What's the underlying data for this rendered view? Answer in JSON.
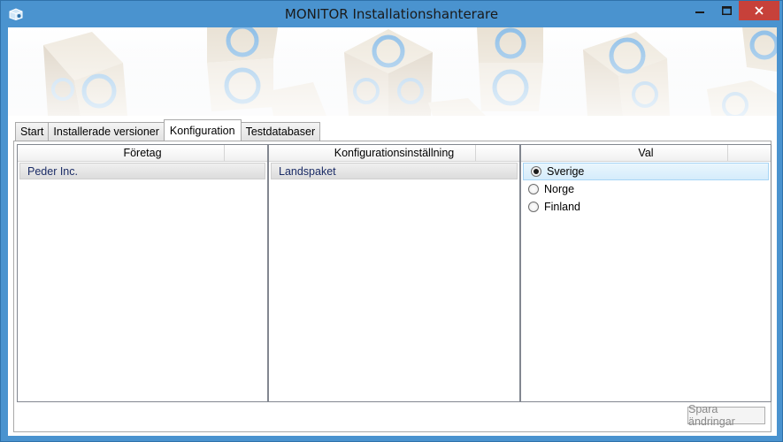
{
  "window": {
    "title": "MONITOR Installationshanterare",
    "accent_color": "#4a93cf",
    "close_color": "#c7413a"
  },
  "tabs": [
    {
      "label": "Start",
      "active": false
    },
    {
      "label": "Installerade versioner",
      "active": false
    },
    {
      "label": "Konfiguration",
      "active": true
    },
    {
      "label": "Testdatabaser",
      "active": false
    }
  ],
  "companies": {
    "header": "Företag",
    "items": [
      "Peder Inc."
    ]
  },
  "settings": {
    "header": "Konfigurationsinställning",
    "items": [
      "Landspaket"
    ]
  },
  "choices": {
    "header": "Val",
    "options": [
      {
        "label": "Sverige",
        "checked": true
      },
      {
        "label": "Norge",
        "checked": false
      },
      {
        "label": "Finland",
        "checked": false
      }
    ]
  },
  "actions": {
    "save_label": "Spara ändringar"
  },
  "icons": {
    "app": "box-app-icon",
    "minimize": "minimize-icon",
    "maximize": "maximize-icon",
    "close": "close-icon"
  }
}
